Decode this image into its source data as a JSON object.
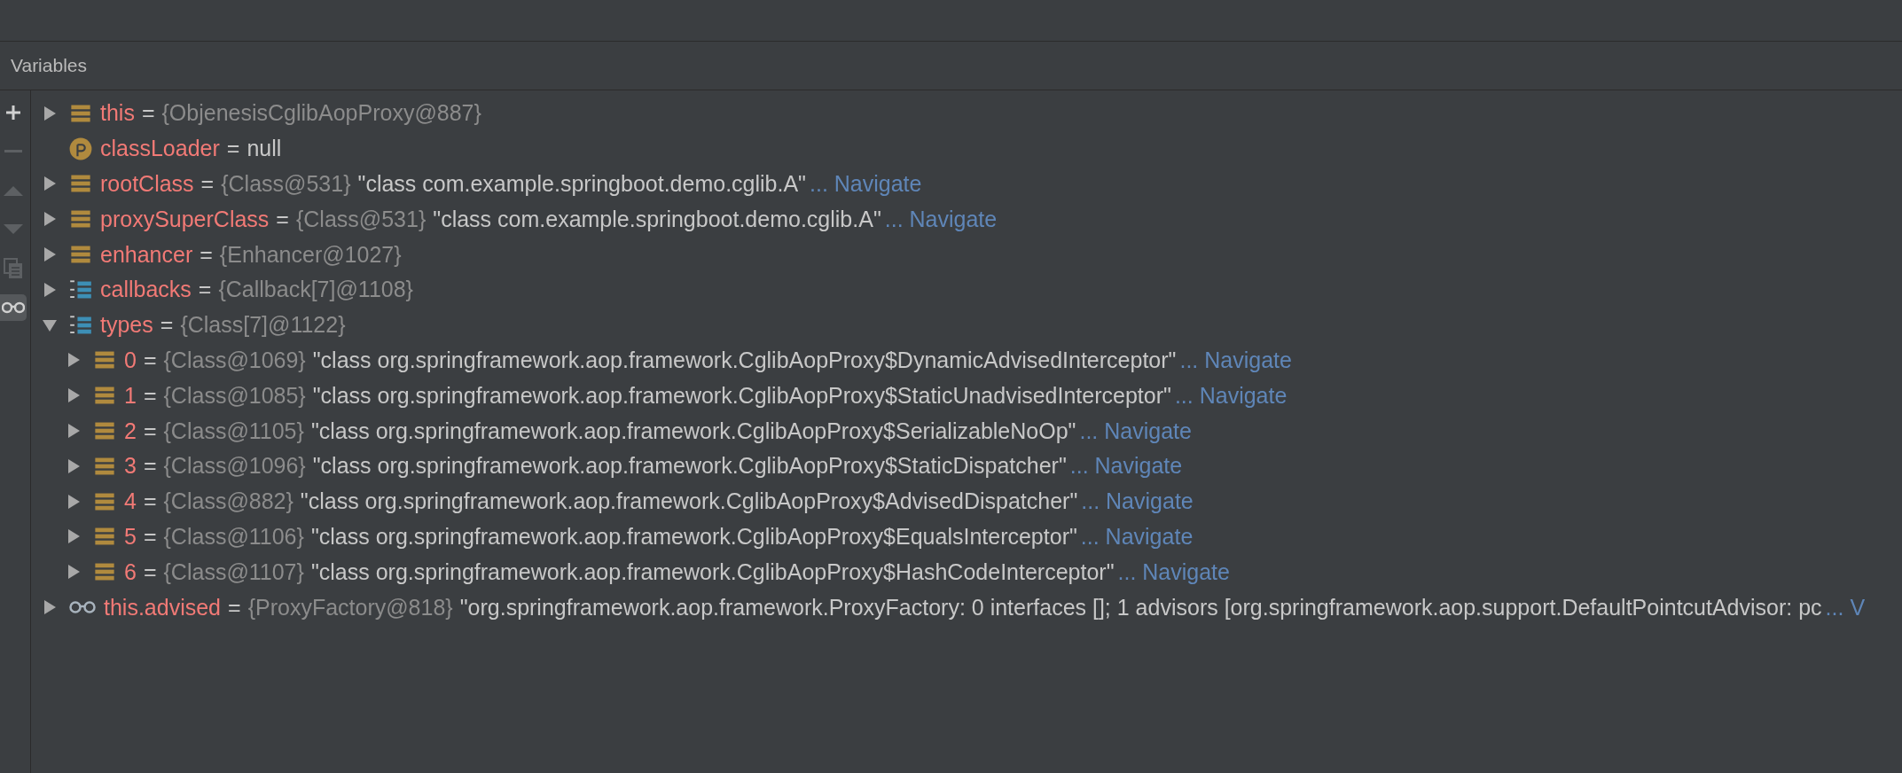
{
  "panel": {
    "title": "Variables"
  },
  "toolbar": [
    {
      "kind": "add",
      "selected": false
    },
    {
      "kind": "remove",
      "selected": false
    },
    {
      "kind": "up",
      "selected": false
    },
    {
      "kind": "down",
      "selected": false
    },
    {
      "kind": "copy",
      "selected": false
    },
    {
      "kind": "watch",
      "selected": true
    }
  ],
  "variables": [
    {
      "kind": "object",
      "expanded": false,
      "name": "this",
      "sep": "=",
      "type": "{ObjenesisCglibAopProxy@887}"
    },
    {
      "kind": "primitive",
      "name": "classLoader",
      "sep": "=",
      "value": "null"
    },
    {
      "kind": "object",
      "expanded": false,
      "name": "rootClass",
      "sep": "=",
      "type": "{Class@531}",
      "value": "\"class com.example.springboot.demo.cglib.A\"",
      "link": "... Navigate"
    },
    {
      "kind": "object",
      "expanded": false,
      "name": "proxySuperClass",
      "sep": "=",
      "type": "{Class@531}",
      "value": "\"class com.example.springboot.demo.cglib.A\"",
      "link": "... Navigate"
    },
    {
      "kind": "object",
      "expanded": false,
      "name": "enhancer",
      "sep": "=",
      "type": "{Enhancer@1027}"
    },
    {
      "kind": "array",
      "expanded": false,
      "name": "callbacks",
      "sep": "=",
      "type": "{Callback[7]@1108}"
    },
    {
      "kind": "array",
      "expanded": true,
      "name": "types",
      "sep": "=",
      "type": "{Class[7]@1122}",
      "children": [
        {
          "kind": "object",
          "expanded": false,
          "name": "0",
          "sep": "=",
          "type": "{Class@1069}",
          "value": "\"class org.springframework.aop.framework.CglibAopProxy$DynamicAdvisedInterceptor\"",
          "link": "... Navigate"
        },
        {
          "kind": "object",
          "expanded": false,
          "name": "1",
          "sep": "=",
          "type": "{Class@1085}",
          "value": "\"class org.springframework.aop.framework.CglibAopProxy$StaticUnadvisedInterceptor\"",
          "link": "... Navigate"
        },
        {
          "kind": "object",
          "expanded": false,
          "name": "2",
          "sep": "=",
          "type": "{Class@1105}",
          "value": "\"class org.springframework.aop.framework.CglibAopProxy$SerializableNoOp\"",
          "link": "... Navigate"
        },
        {
          "kind": "object",
          "expanded": false,
          "name": "3",
          "sep": "=",
          "type": "{Class@1096}",
          "value": "\"class org.springframework.aop.framework.CglibAopProxy$StaticDispatcher\"",
          "link": "... Navigate"
        },
        {
          "kind": "object",
          "expanded": false,
          "name": "4",
          "sep": "=",
          "type": "{Class@882}",
          "value": "\"class org.springframework.aop.framework.CglibAopProxy$AdvisedDispatcher\"",
          "link": "... Navigate"
        },
        {
          "kind": "object",
          "expanded": false,
          "name": "5",
          "sep": "=",
          "type": "{Class@1106}",
          "value": "\"class org.springframework.aop.framework.CglibAopProxy$EqualsInterceptor\"",
          "link": "... Navigate"
        },
        {
          "kind": "object",
          "expanded": false,
          "name": "6",
          "sep": "=",
          "type": "{Class@1107}",
          "value": "\"class org.springframework.aop.framework.CglibAopProxy$HashCodeInterceptor\"",
          "link": "... Navigate"
        }
      ]
    },
    {
      "kind": "watch",
      "expanded": false,
      "name": "this.advised",
      "sep": "=",
      "type": "{ProxyFactory@818}",
      "value": "\"org.springframework.aop.framework.ProxyFactory: 0 interfaces []; 1 advisors [org.springframework.aop.support.DefaultPointcutAdvisor: pc",
      "link": "... V"
    }
  ]
}
